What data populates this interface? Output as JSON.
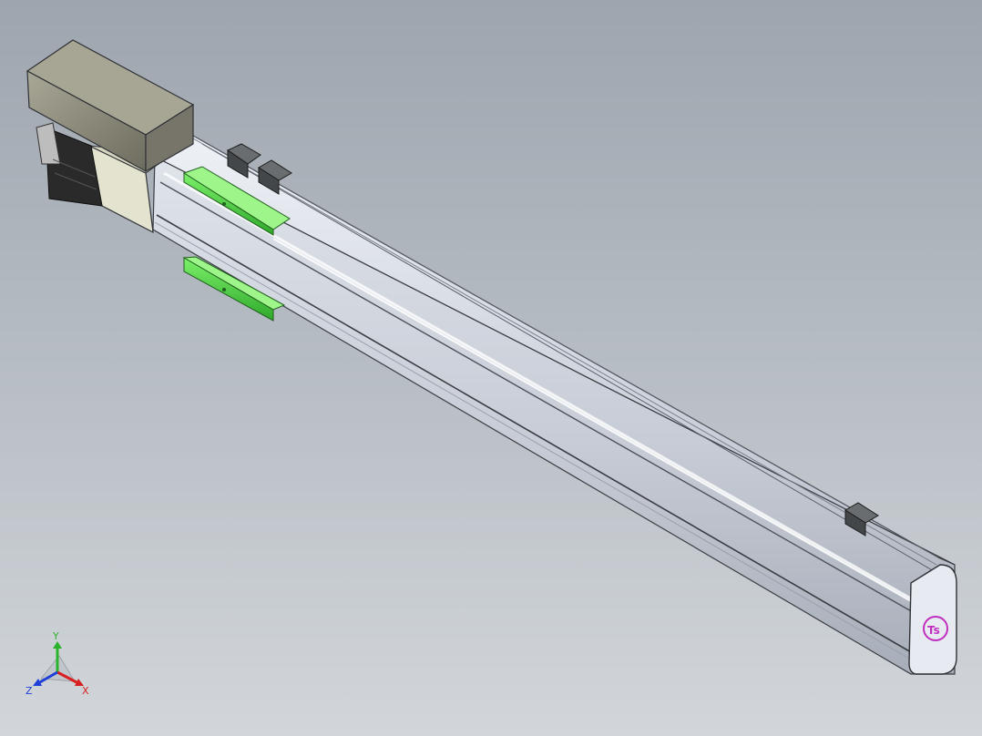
{
  "viewport": {
    "background_top": "#9ea5ae",
    "background_bottom": "#d2d6da"
  },
  "model": {
    "parts": [
      "motor-cover",
      "motor-body",
      "coupling-housing",
      "linear-actuator-rail",
      "carriage-slider-upper",
      "carriage-slider-lower",
      "limit-sensor-left-a",
      "limit-sensor-left-b",
      "limit-sensor-right",
      "end-cap"
    ],
    "colors": {
      "rail": "#c9cfdb",
      "rail_shadow": "#8f96a3",
      "motor_cover": "#8e8c7c",
      "motor_body": "#222222",
      "coupling": "#e3e3cf",
      "carriage": "#4fd64a",
      "sensor": "#5c5f62",
      "logo": "#c030c0"
    },
    "end_cap_logo": "Ts"
  },
  "triad": {
    "x_label": "X",
    "y_label": "Y",
    "z_label": "Z",
    "x_color": "#d92020",
    "y_color": "#2bb32b",
    "z_color": "#1f3fd9"
  }
}
